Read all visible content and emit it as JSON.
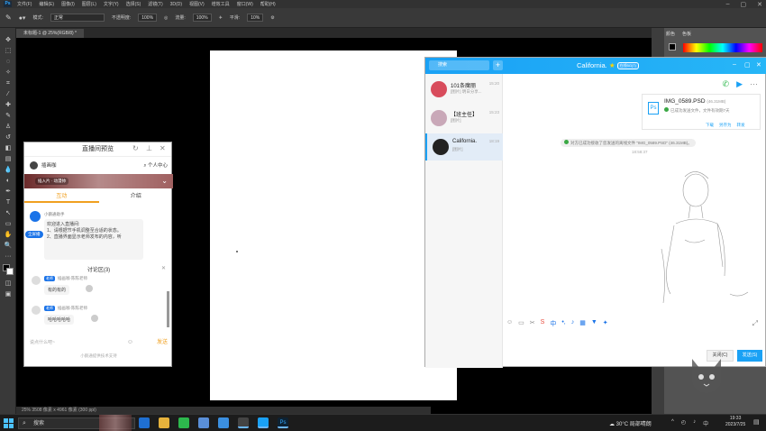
{
  "photoshop": {
    "menu": [
      "文件(F)",
      "编辑(E)",
      "图像(I)",
      "图层(L)",
      "文字(Y)",
      "选择(S)",
      "滤镜(T)",
      "3D(D)",
      "视图(V)",
      "增效工具",
      "窗口(W)",
      "帮助(H)"
    ],
    "options": {
      "mode_label": "模式:",
      "mode_value": "正常",
      "opacity_label": "不透明度:",
      "opacity_value": "100%",
      "flow_label": "流量:",
      "flow_value": "100%",
      "smooth_label": "平滑:",
      "smooth_value": "10%"
    },
    "doc_tab": "未标题-1 @ 25%(RGB/8) *",
    "status": "25%   3508 像素 x 4961 像素 (300 ppi)",
    "panel_tabs": [
      "颜色",
      "色板"
    ]
  },
  "live_preview": {
    "title": "直播间预览",
    "username": "插画咖",
    "personal_center": "个人中心",
    "banner_text": "插入片 · 动漫帅",
    "tabs": [
      "互动",
      "介绍"
    ],
    "bot_name": "小鹅通助手",
    "welcome_lines": [
      "欢迎进入直播间:",
      "1、请根据节手机调整至合适的状态。",
      "2、直播界面显示老师发布的内容，听"
    ],
    "pill": "全屏播",
    "discussion_title": "讨论区(3)",
    "messages": [
      {
        "badge": "老师",
        "name": "插画咖·陈陈老师",
        "text": "有的有的"
      },
      {
        "badge": "老师",
        "name": "插画咖·陈陈老师",
        "text": "哈哈哈哈哈"
      }
    ],
    "input_placeholder": "说点什么吧~",
    "send": "发送",
    "footer": "小鹅通提供技术支持"
  },
  "qq": {
    "search_placeholder": "搜索",
    "title": "California.",
    "title_badge": "在线5G(7)",
    "conversations": [
      {
        "name": "101条魔丽",
        "msg": "[图片] 明日分享...",
        "time": "15:20",
        "color": "#d84c5c"
      },
      {
        "name": "【班主任】",
        "msg": "[图片]",
        "time": "15:23",
        "color": "#c9a8b8"
      },
      {
        "name": "California.",
        "msg": "[图片]",
        "time": "18:19",
        "color": "#222222"
      }
    ],
    "file": {
      "name": "IMG_0589.PSD",
      "size": "(46.31MB)",
      "status": "已成功发送文件，文件有效期7天",
      "links": [
        "下载",
        "另存为",
        "转发"
      ]
    },
    "system_note": "对方已成功接收了您发送的离线文件 \"IMG_0589.PSD\" (46.31MB)。",
    "timestamp": "18:58:37",
    "close_label": "关闭(C)",
    "send_label": "发送(S)"
  },
  "taskbar": {
    "search_label": "搜索",
    "weather": "30°C 局部晴朗",
    "time": "19:33",
    "date": "2023/7/25"
  }
}
